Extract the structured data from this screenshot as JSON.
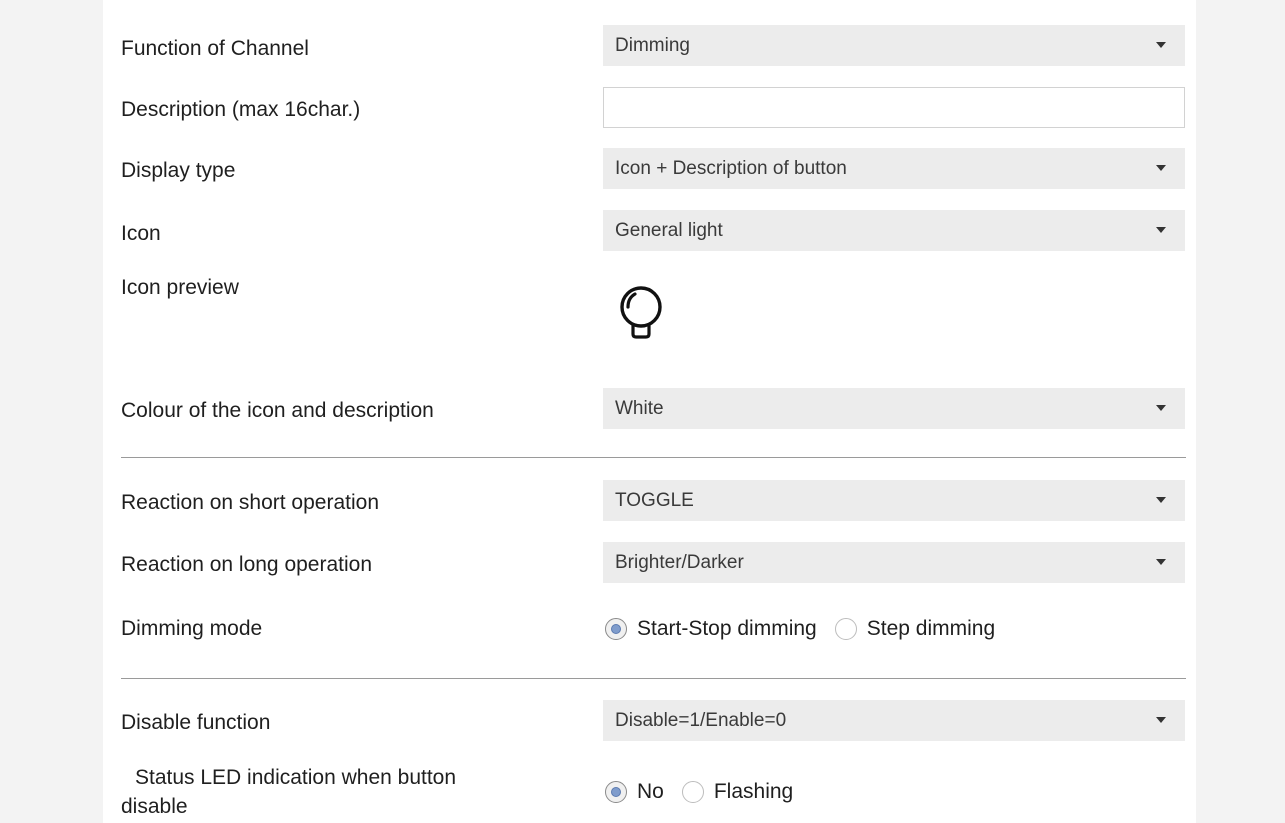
{
  "fields": {
    "function_of_channel": {
      "label": "Function of Channel",
      "value": "Dimming"
    },
    "description": {
      "label": "Description (max 16char.)",
      "value": ""
    },
    "display_type": {
      "label": "Display type",
      "value": "Icon + Description of button"
    },
    "icon": {
      "label": "Icon",
      "value": "General light"
    },
    "icon_preview": {
      "label": "Icon preview",
      "icon": "lightbulb-icon"
    },
    "colour": {
      "label": "Colour of the icon and description",
      "value": "White"
    },
    "short_operation": {
      "label": "Reaction on short operation",
      "value": "TOGGLE"
    },
    "long_operation": {
      "label": "Reaction on long operation",
      "value": "Brighter/Darker"
    },
    "dimming_mode": {
      "label": "Dimming mode",
      "options": [
        "Start-Stop dimming",
        "Step dimming"
      ],
      "selected": "Start-Stop dimming"
    },
    "disable_function": {
      "label": "Disable function",
      "value": "Disable=1/Enable=0"
    },
    "status_led": {
      "label_line1": "Status LED indication when button",
      "label_line2": "disable",
      "options": [
        "No",
        "Flashing"
      ],
      "selected": "No"
    }
  },
  "colors": {
    "select_bg": "#ececec",
    "radio_accent": "#7f9ccc"
  }
}
